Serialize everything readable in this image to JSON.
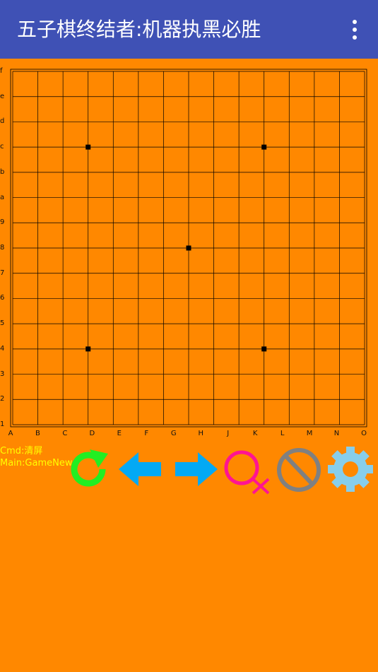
{
  "appbar": {
    "title": "五子棋终结者:机器执黑必胜",
    "menu_icon": "more-vert-icon"
  },
  "board": {
    "size": 15,
    "row_labels": [
      "f",
      "e",
      "d",
      "c",
      "b",
      "a",
      "9",
      "8",
      "7",
      "6",
      "5",
      "4",
      "3",
      "2",
      "1"
    ],
    "col_labels": [
      "A",
      "B",
      "C",
      "D",
      "E",
      "F",
      "G",
      "H",
      "J",
      "K",
      "L",
      "M",
      "N",
      "O"
    ],
    "star_points": [
      "D12",
      "L12",
      "H8",
      "D4",
      "L4"
    ],
    "line_color": "#000000"
  },
  "status": {
    "cmd": "Cmd:清屏",
    "main": "Main:GameNew"
  },
  "toolbar": {
    "buttons": [
      {
        "icon": "refresh-icon",
        "color": "#22ee22"
      },
      {
        "icon": "arrow-left-icon",
        "color": "#03a9f4"
      },
      {
        "icon": "arrow-right-icon",
        "color": "#03a9f4"
      },
      {
        "icon": "search-icon",
        "color": "#ff1493"
      },
      {
        "icon": "cancel-icon",
        "color": "#808080"
      },
      {
        "icon": "gear-icon",
        "color": "#87ceeb"
      }
    ]
  }
}
